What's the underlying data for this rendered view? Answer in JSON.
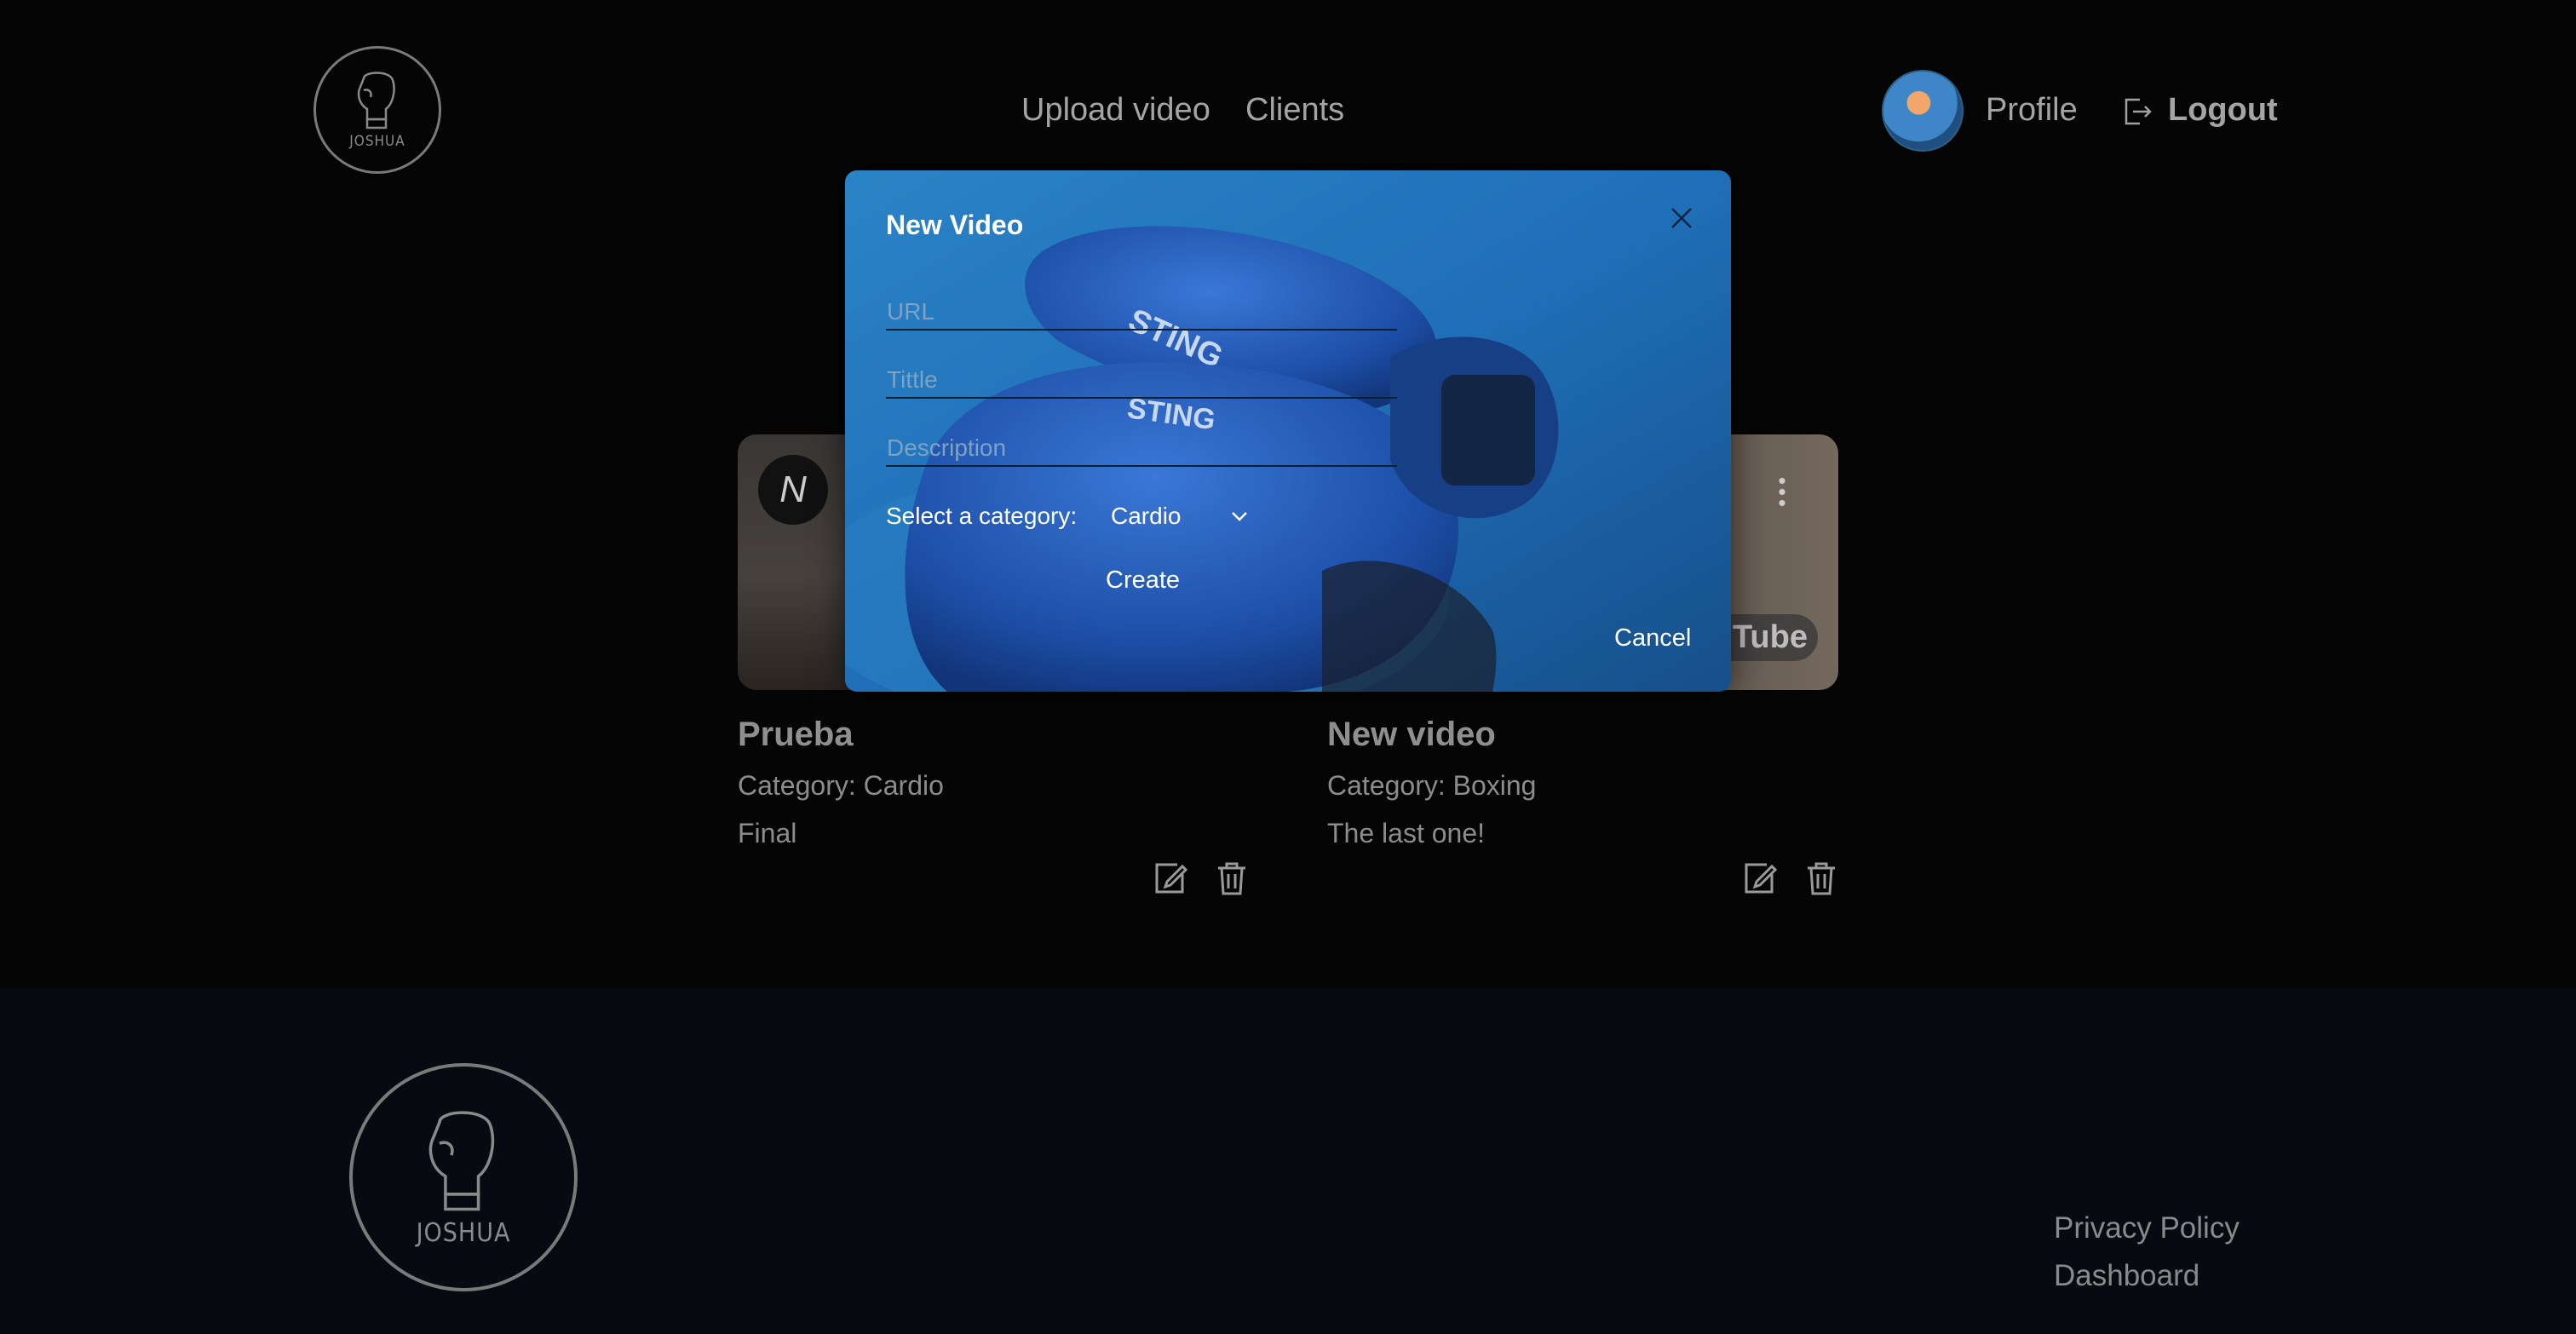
{
  "brand": {
    "logo_text": "JOSHUA"
  },
  "nav": {
    "upload": "Upload video",
    "clients": "Clients"
  },
  "user": {
    "profile": "Profile",
    "logout": "Logout"
  },
  "cards": [
    {
      "title": "Prueba",
      "category": "Category: Cardio",
      "description": "Final"
    },
    {
      "title": "New video",
      "category": "Category: Boxing",
      "description": "The last one!",
      "thumb_badge": "uTube"
    }
  ],
  "modal": {
    "title": "New Video",
    "url_placeholder": "URL",
    "title_placeholder": "Tittle",
    "description_placeholder": "Description",
    "category_label": "Select a category:",
    "category_selected": "Cardio",
    "create_label": "Create",
    "cancel_label": "Cancel",
    "bg_text_1": "STING",
    "bg_text_2": "STING"
  },
  "footer": {
    "privacy": "Privacy Policy",
    "dashboard": "Dashboard"
  },
  "colors": {
    "modal_blue": "#1f6fb8",
    "background": "#050505",
    "footer_bg": "#070a10"
  }
}
